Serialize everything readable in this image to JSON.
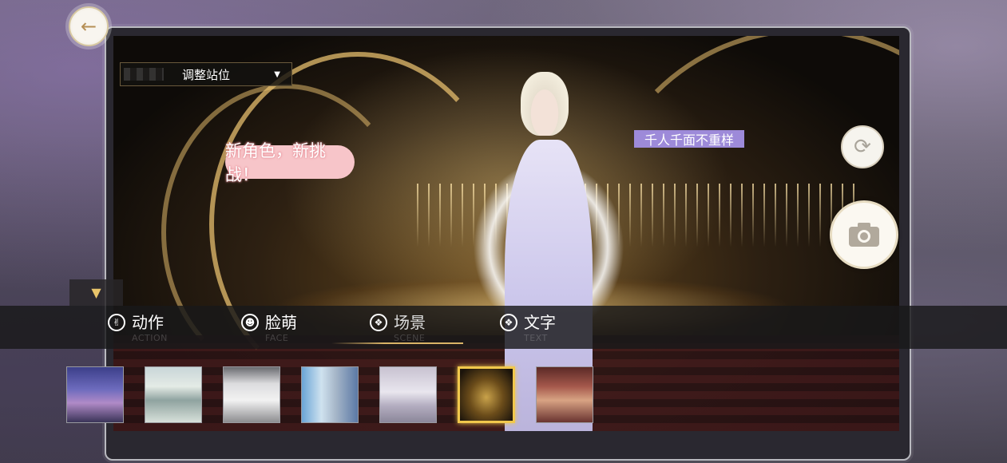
{
  "header": {
    "back_button_icon": "arrow-left-icon"
  },
  "position_select": {
    "label": "调整站位",
    "icon": "triangle-down-icon"
  },
  "stickers": {
    "pink": "新角色，新挑战！",
    "purple": "千人千面不重样"
  },
  "controls": {
    "rotate_icon": "rotate-icon",
    "camera_icon": "camera-icon",
    "collapse_icon": "triangle-down-icon"
  },
  "tabs": [
    {
      "label": "动作",
      "en": "ACTION",
      "icon": "action-icon"
    },
    {
      "label": "脸萌",
      "en": "FACE",
      "icon": "face-icon"
    },
    {
      "label": "场景",
      "en": "SCENE",
      "icon": "scene-icon",
      "active": true
    },
    {
      "label": "文字",
      "en": "TEXT",
      "icon": "text-icon"
    }
  ],
  "scene_thumbnails": [
    {
      "name": "scene-thumb-night-city"
    },
    {
      "name": "scene-thumb-film-set"
    },
    {
      "name": "scene-thumb-white-studio"
    },
    {
      "name": "scene-thumb-wardrobe"
    },
    {
      "name": "scene-thumb-living-room"
    },
    {
      "name": "scene-thumb-golden-stage",
      "selected": true
    },
    {
      "name": "scene-thumb-red-hall"
    }
  ],
  "colors": {
    "accent_gold": "#f1c84c",
    "sticker_pink": "#f7c5c9",
    "sticker_purple": "#9d8ad9"
  }
}
